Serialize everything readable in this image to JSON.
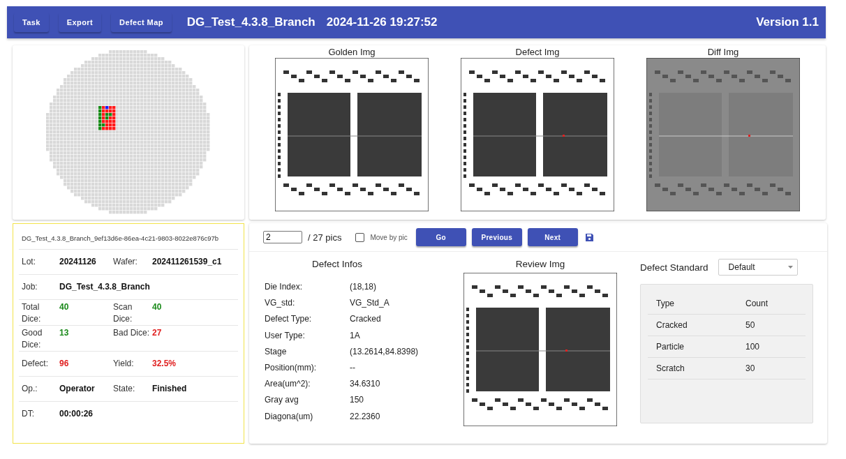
{
  "header": {
    "buttons": [
      "Task",
      "Export",
      "Defect Map"
    ],
    "title": "DG_Test_4.3.8_Branch",
    "datetime": "2024-11-26 19:27:52",
    "version": "Version 1.1"
  },
  "images": [
    {
      "title": "Golden Img",
      "kind": "golden"
    },
    {
      "title": "Defect Img",
      "kind": "defect"
    },
    {
      "title": "Diff Img",
      "kind": "diff"
    }
  ],
  "info_card": {
    "id": "DG_Test_4.3.8_Branch_9ef13d6e-86ea-4c21-9803-8022e876c97b",
    "rows": [
      [
        {
          "label": "Lot:",
          "value": "20241126"
        },
        {
          "label": "Wafer:",
          "value": "202411261539_c1"
        }
      ],
      [
        {
          "label": "Job:",
          "value": "DG_Test_4.3.8_Branch"
        }
      ],
      [
        {
          "label": "Total Dice:",
          "value": "40",
          "color": "#1a8a1a"
        },
        {
          "label": "Scan Dice:",
          "value": "40",
          "color": "#1a8a1a"
        }
      ],
      [
        {
          "label": "Good Dice:",
          "value": "13",
          "color": "#1a8a1a"
        },
        {
          "label": "Bad Dice:",
          "value": "27",
          "color": "#e02020"
        }
      ],
      [
        {
          "label": "Defect:",
          "value": "96",
          "color": "#e02020"
        },
        {
          "label": "Yield:",
          "value": "32.5%",
          "color": "#e02020"
        }
      ],
      [
        {
          "label": "Op.:",
          "value": "Operator"
        },
        {
          "label": "State:",
          "value": "Finished"
        }
      ],
      [
        {
          "label": "DT:",
          "value": "00:00:26"
        }
      ]
    ]
  },
  "navigator": {
    "page": "2",
    "total": "/ 27 pics",
    "move_by_pic": {
      "label": "Move by pic",
      "checked": false
    },
    "buttons": [
      "Go",
      "Previous",
      "Next"
    ]
  },
  "defect_infos": {
    "title": "Defect Infos",
    "fields": [
      {
        "label": "Die Index:",
        "value": "(18,18)"
      },
      {
        "label": "VG_std:",
        "value": "VG_Std_A"
      },
      {
        "label": "Defect Type:",
        "value": "Cracked"
      },
      {
        "label": "User Type:",
        "value": "1A"
      },
      {
        "label": "Stage",
        "value": "(13.2614,84.8398)"
      },
      {
        "label": "Position(mm):",
        "value": "--"
      },
      {
        "label": "Area(um^2):",
        "value": "34.6310"
      },
      {
        "label": "Gray avg",
        "value": "150"
      },
      {
        "label": "Diagona(um)",
        "value": "22.2360"
      }
    ]
  },
  "review": {
    "title": "Review Img"
  },
  "defect_standard": {
    "label": "Defect Standard",
    "selected": "Default",
    "columns": [
      "Type",
      "Count"
    ],
    "rows": [
      [
        "Cracked",
        "50"
      ],
      [
        "Particle",
        "100"
      ],
      [
        "Scratch",
        "30"
      ]
    ]
  }
}
